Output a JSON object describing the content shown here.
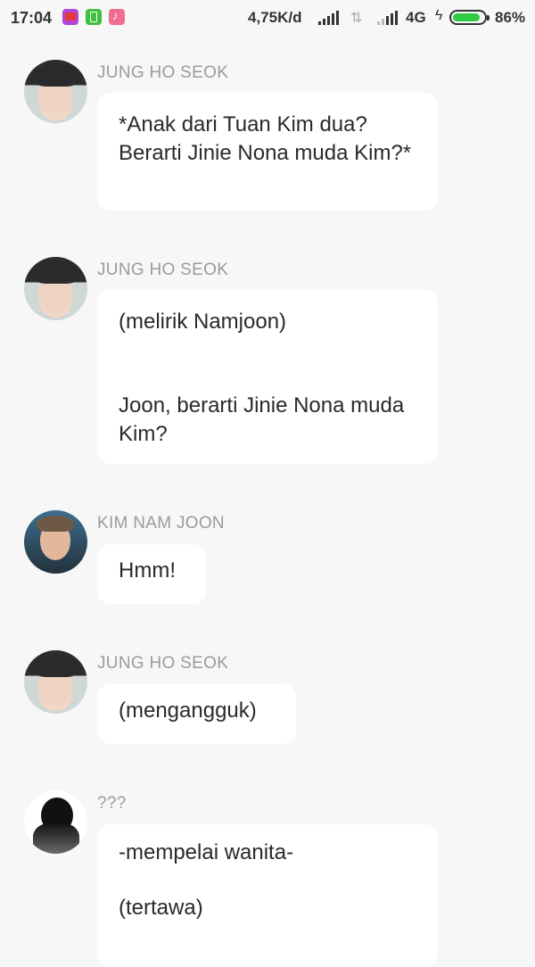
{
  "status_bar": {
    "time": "17:04",
    "speed": "4,75K/d",
    "network": "4G",
    "battery_percent": "86%",
    "battery_level": 0.86,
    "icons": [
      "youtube-icon",
      "battery-saver-icon",
      "music-icon",
      "signal-icon",
      "data-arrows-icon",
      "charging-icon",
      "battery-icon"
    ]
  },
  "messages": [
    {
      "sender": "JUNG HO SEOK",
      "avatar": "jung-ho-seok-avatar",
      "lines": [
        "*Anak dari Tuan Kim dua? Berarti Jinie Nona muda Kim?*"
      ]
    },
    {
      "sender": "JUNG HO SEOK",
      "avatar": "jung-ho-seok-avatar",
      "lines": [
        "(melirik Namjoon)",
        "Joon, berarti Jinie Nona muda Kim?"
      ]
    },
    {
      "sender": "KIM NAM JOON",
      "avatar": "kim-nam-joon-avatar",
      "lines": [
        "Hmm!"
      ]
    },
    {
      "sender": "JUNG HO SEOK",
      "avatar": "jung-ho-seok-avatar",
      "lines": [
        "(mengangguk)"
      ]
    },
    {
      "sender": "???",
      "avatar": "unknown-silhouette-avatar",
      "lines": [
        "-mempelai wanita-",
        "(tertawa)"
      ]
    }
  ]
}
